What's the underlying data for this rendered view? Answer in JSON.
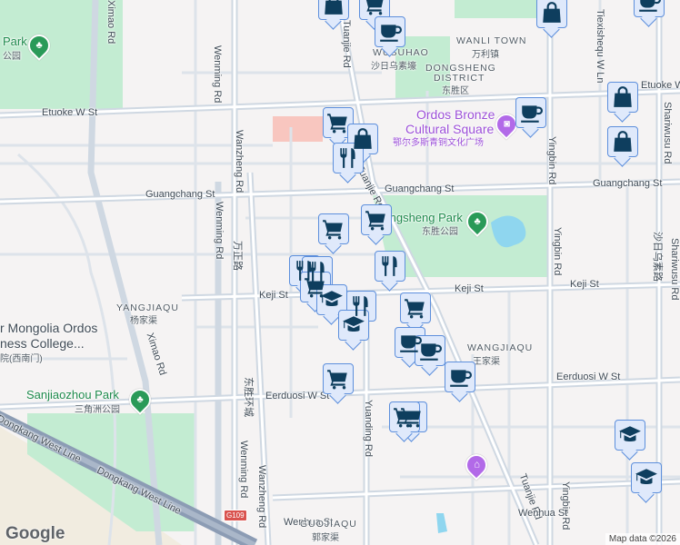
{
  "map": {
    "areas": {
      "wusuhao": {
        "en": "WUSUHAO",
        "cn": "沙日乌素壕"
      },
      "wanli": {
        "en": "WANLI TOWN",
        "cn": "万利镇"
      },
      "dongsheng_1": "DONGSHENG",
      "dongsheng_2": "DISTRICT",
      "dongsheng_cn": "东胜区",
      "yangjiaqu": {
        "en": "YANGJIAQU",
        "cn": "杨家渠"
      },
      "wangjiaqu": {
        "en": "WANGJIAQU",
        "cn": "王家渠"
      },
      "guojiaqu": {
        "en": "GUOJIAQU",
        "cn": "郭家渠"
      }
    },
    "parks": {
      "top_left": {
        "en": "Park",
        "cn": "公园"
      },
      "dongsheng": {
        "en": "Dongsheng Park",
        "cn": "东胜公园"
      },
      "sanjiaozhou": {
        "en": "Sanjiaozhou Park",
        "cn": "三角洲公园"
      }
    },
    "pois": {
      "bronze_1": "Ordos Bronze",
      "bronze_2": "Cultural Square",
      "bronze_cn": "鄂尔多斯青铜文化广场",
      "college_1": "r Mongolia Ordos",
      "college_2": "ness College...",
      "college_cn": "院(西南门)"
    },
    "roads": {
      "etuoke_w": "Etuoke W St",
      "etuoke_e": "Etuoke W St",
      "guangchang_w": "Guangchang St",
      "guangchang_m": "Guangchang St",
      "guangchang_e": "Guangchang St",
      "keji_w": "Keji St",
      "keji_m": "Keji St",
      "keji_e": "Keji St",
      "eerduosi_w": "Eerduosi W St",
      "eerduosi_e": "Eerduosi W St",
      "wenhua_w": "Wenhua St",
      "wenhua_e": "Wenhua St",
      "ximao_top": "Ximao Rd",
      "ximao_mid": "Ximao Rd",
      "wenming_top": "Wenming Rd",
      "wenming_mid": "Wenming Rd",
      "wenming_bot": "Wenming Rd",
      "wanzheng_top": "Wanzheng Rd",
      "wanzheng_cn": "万正路",
      "wanzheng_bot": "Wanzheng Rd",
      "huancheng_cn": "东胜环城",
      "tuanjie_top": "Tuanjie Rd",
      "tuanjie_mid": "Tuanjie Rd",
      "tuanjie_bot": "Tuanjie Rd",
      "yuanding": "Yuanding Rd",
      "yingbin_top": "Yingbin Rd",
      "yingbin_mid": "Yingbin Rd",
      "yingbin_bot": "Yingbin Rd",
      "tiexishequ": "Tiexishequ W Ln",
      "shariwusu_top": "Shariwusu Rd",
      "shariwusu_cn": "沙日乌素路",
      "shariwusu_bot": "Shariwusu Rd",
      "dongkang_1": "Dongkang West Line",
      "dongkang_2": "Dongkang West Line",
      "g109": "G109"
    },
    "logo": "Google",
    "attribution": "Map data ©2026"
  },
  "colors": {
    "marker_fill": "#dfe9fb",
    "marker_border": "#5d8fdc",
    "marker_icon": "#0e3e5e",
    "park": "#c3ecd2",
    "park_label": "#1e8a4c",
    "poi_purple": "#9c4fd8"
  }
}
